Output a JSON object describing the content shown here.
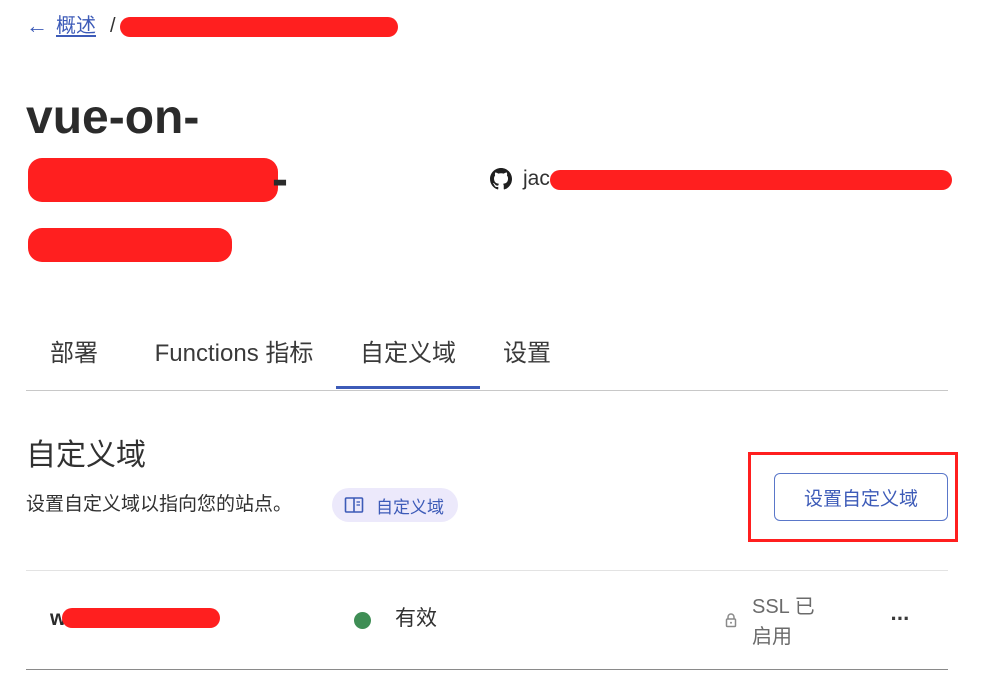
{
  "breadcrumb": {
    "back_arrow": "←",
    "parent_label": "概述",
    "separator": "/"
  },
  "project": {
    "title_visible": "vue-on-",
    "title_dash": "-",
    "repo_visible": "jac"
  },
  "icons": {
    "back": "arrow-left-icon",
    "repo": "github-icon",
    "docs": "book-icon",
    "ssl": "lock-icon",
    "more": "ellipsis-icon"
  },
  "tabs": [
    {
      "label": "部署",
      "active": false
    },
    {
      "label": "Functions 指标",
      "active": false
    },
    {
      "label": "自定义域",
      "active": true
    },
    {
      "label": "设置",
      "active": false
    }
  ],
  "section": {
    "title": "自定义域",
    "description": "设置自定义域以指向您的站点。",
    "doc_chip_label": "自定义域",
    "button_label": "设置自定义域"
  },
  "domains": [
    {
      "name_visible": "w",
      "status": "有效",
      "ssl": "SSL 已启用",
      "more": "···"
    }
  ],
  "colors": {
    "accent": "#3d5bb8",
    "status_valid": "#3f8e55",
    "redaction": "#ff1f1f",
    "chip_bg": "#ece9fb"
  }
}
